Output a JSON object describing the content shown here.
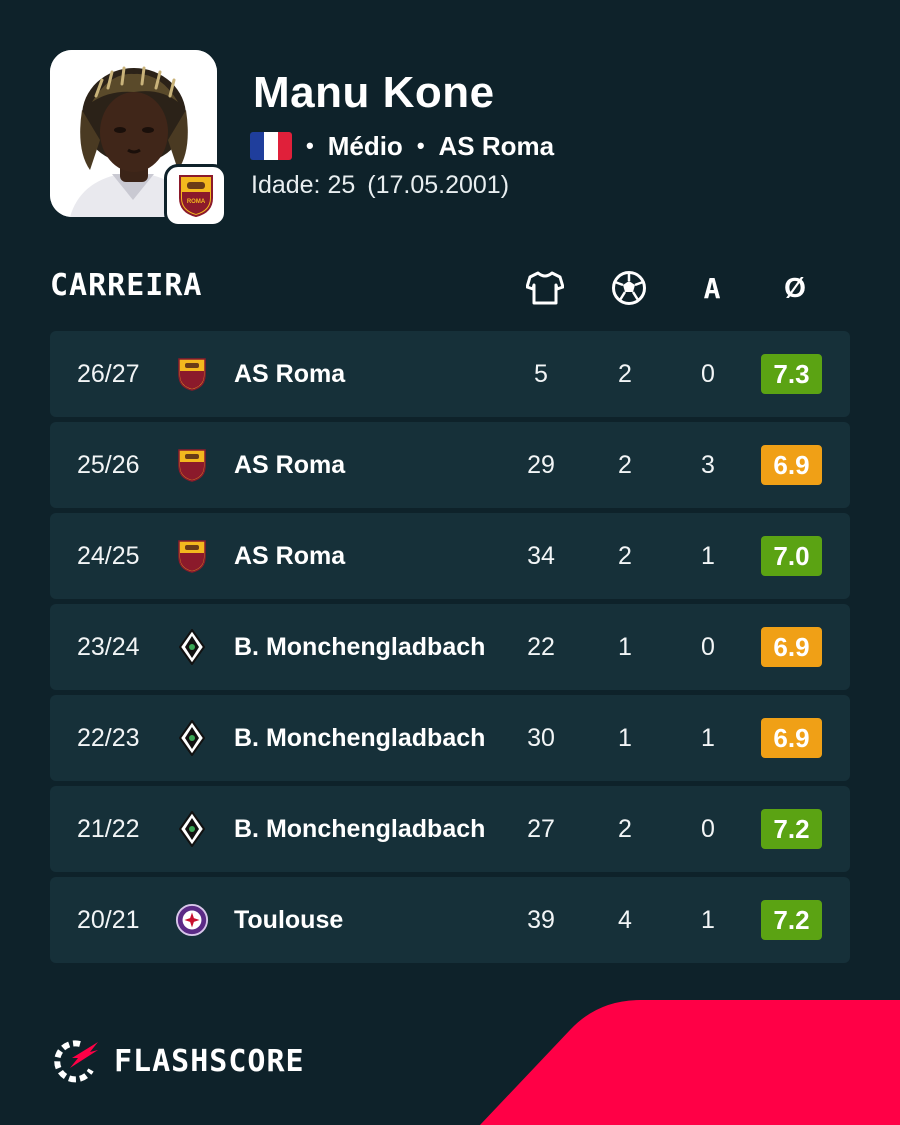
{
  "player": {
    "name": "Manu Kone",
    "position": "Médio",
    "club": "AS Roma",
    "age_label": "Idade: 25",
    "birth_date": "(17.05.2001)",
    "nationality_flag": [
      "#1f3e9c",
      "#ffffff",
      "#e0203a"
    ]
  },
  "career": {
    "title": "CARREIRA",
    "columns": [
      {
        "icon": "shirt-icon",
        "meaning": "appearances"
      },
      {
        "icon": "ball-icon",
        "meaning": "goals"
      },
      {
        "label": "A",
        "meaning": "assists"
      },
      {
        "label": "Ø",
        "meaning": "average rating"
      }
    ],
    "rows": [
      {
        "season": "26/27",
        "team": "AS Roma",
        "logo": "roma-crest-icon",
        "apps": "5",
        "goals": "2",
        "assists": "0",
        "rating": "7.3",
        "rating_color": "#5ba313"
      },
      {
        "season": "25/26",
        "team": "AS Roma",
        "logo": "roma-crest-icon",
        "apps": "29",
        "goals": "2",
        "assists": "3",
        "rating": "6.9",
        "rating_color": "#f0a016"
      },
      {
        "season": "24/25",
        "team": "AS Roma",
        "logo": "roma-crest-icon",
        "apps": "34",
        "goals": "2",
        "assists": "1",
        "rating": "7.0",
        "rating_color": "#5ba313"
      },
      {
        "season": "23/24",
        "team": "B. Monchengladbach",
        "logo": "gladbach-crest-icon",
        "apps": "22",
        "goals": "1",
        "assists": "0",
        "rating": "6.9",
        "rating_color": "#f0a016"
      },
      {
        "season": "22/23",
        "team": "B. Monchengladbach",
        "logo": "gladbach-crest-icon",
        "apps": "30",
        "goals": "1",
        "assists": "1",
        "rating": "6.9",
        "rating_color": "#f0a016"
      },
      {
        "season": "21/22",
        "team": "B. Monchengladbach",
        "logo": "gladbach-crest-icon",
        "apps": "27",
        "goals": "2",
        "assists": "0",
        "rating": "7.2",
        "rating_color": "#5ba313"
      },
      {
        "season": "20/21",
        "team": "Toulouse",
        "logo": "toulouse-crest-icon",
        "apps": "39",
        "goals": "4",
        "assists": "1",
        "rating": "7.2",
        "rating_color": "#5ba313"
      }
    ]
  },
  "brand": {
    "name": "FLASHSCORE",
    "accent_color": "#ff0046"
  },
  "colors": {
    "background": "#0e222a",
    "row_background": "#163039"
  }
}
